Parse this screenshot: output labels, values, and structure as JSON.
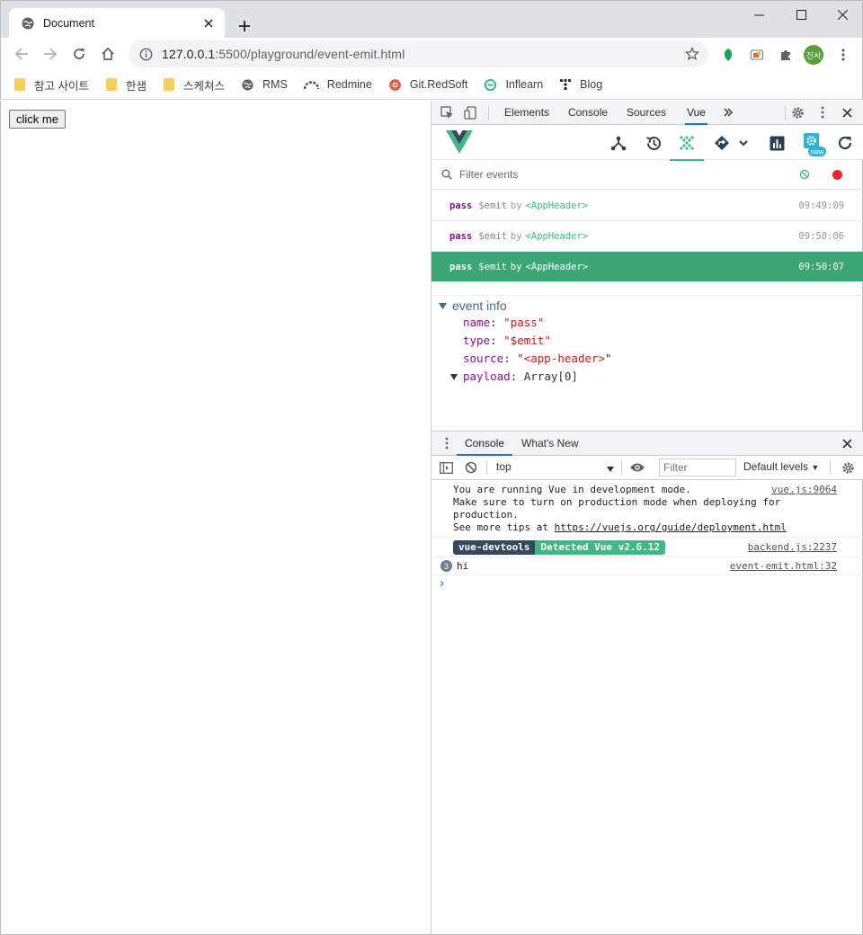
{
  "browser": {
    "tab_title": "Document",
    "url_host": "127.0.0.1",
    "url_rest": ":5500/playground/event-emit.html",
    "profile_initials": "진서"
  },
  "bookmarks": [
    {
      "label": "참고 사이트",
      "icon": "folder-icon"
    },
    {
      "label": "한샘",
      "icon": "folder-icon"
    },
    {
      "label": "스케쳐스",
      "icon": "folder-icon"
    },
    {
      "label": "RMS",
      "icon": "globe-icon"
    },
    {
      "label": "Redmine",
      "icon": "redmine-icon"
    },
    {
      "label": "Git.RedSoft",
      "icon": "git-icon"
    },
    {
      "label": "Inflearn",
      "icon": "inflearn-icon"
    },
    {
      "label": "Blog",
      "icon": "blog-icon"
    }
  ],
  "page": {
    "button_label": "click me"
  },
  "devtools": {
    "tabs": [
      "Elements",
      "Console",
      "Sources",
      "Vue"
    ],
    "active_tab": "Vue",
    "vue": {
      "filter_placeholder": "Filter events",
      "new_badge": "new",
      "events": [
        {
          "name": "pass",
          "type": "$emit",
          "by": "by",
          "component": "<AppHeader>",
          "time": "09:49:09"
        },
        {
          "name": "pass",
          "type": "$emit",
          "by": "by",
          "component": "<AppHeader>",
          "time": "09:50:06"
        },
        {
          "name": "pass",
          "type": "$emit",
          "by": "by",
          "component": "<AppHeader>",
          "time": "09:50:07"
        }
      ],
      "info": {
        "title": "event info",
        "name_key": "name",
        "name_val": "\"pass\"",
        "type_key": "type",
        "type_val": "\"$emit\"",
        "source_key": "source",
        "source_val": "<app-header>",
        "payload_key": "payload",
        "payload_val": "Array[0]"
      }
    },
    "drawer": {
      "tabs": [
        "Console",
        "What's New"
      ],
      "context": "top",
      "filter_placeholder": "Filter",
      "levels": "Default levels",
      "logs": {
        "line1": "You are running Vue in development mode.",
        "line2": "Make sure to turn on production mode when deploying for",
        "line3": "production.",
        "line4_prefix": "See more tips at ",
        "line4_link": "https://vuejs.org/guide/deployment.html",
        "src1": "vue.js:9064",
        "badge_a": "vue-devtools",
        "badge_b": "Detected Vue v2.6.12",
        "src2": "backend.js:2237",
        "hi_count": "3",
        "hi_text": "hi",
        "src3": "event-emit.html:32",
        "prompt": "›"
      }
    }
  },
  "colors": {
    "vue_green": "#42b983",
    "selected_row": "#3ba776",
    "vue_dark": "#35495e"
  }
}
